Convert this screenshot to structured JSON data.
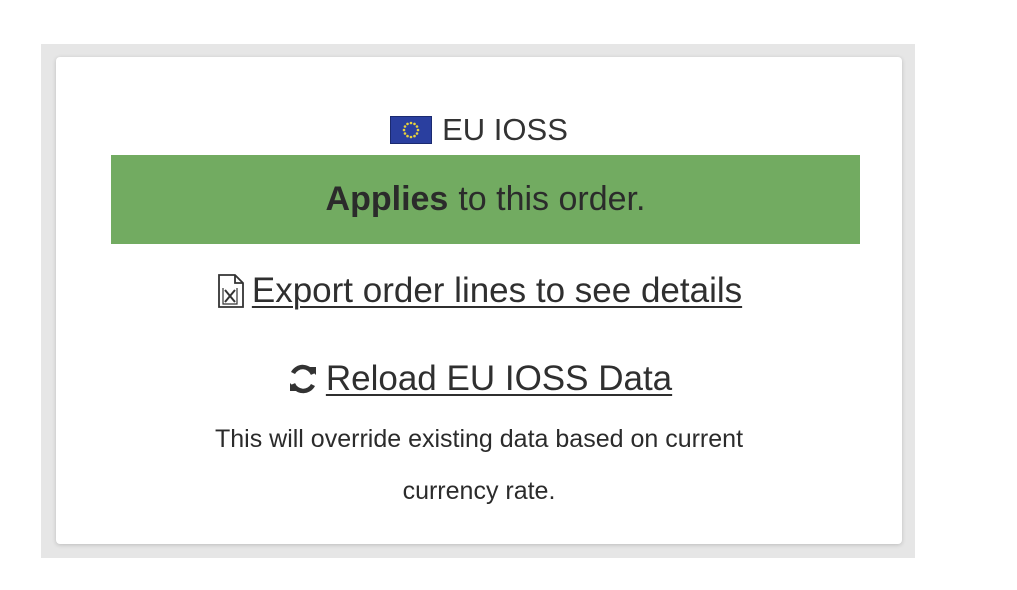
{
  "card": {
    "title": "EU IOSS",
    "flag_icon": "eu-flag-icon",
    "banner": {
      "bold_text": "Applies",
      "rest_text": "to this order.",
      "color": "#72ab61"
    },
    "export_link": {
      "icon": "excel-file-icon",
      "label": "Export order lines to see details"
    },
    "reload_link": {
      "icon": "refresh-icon",
      "label": "Reload EU IOSS Data"
    },
    "note_lines": [
      "This will override existing data based on current",
      "currency rate."
    ]
  }
}
